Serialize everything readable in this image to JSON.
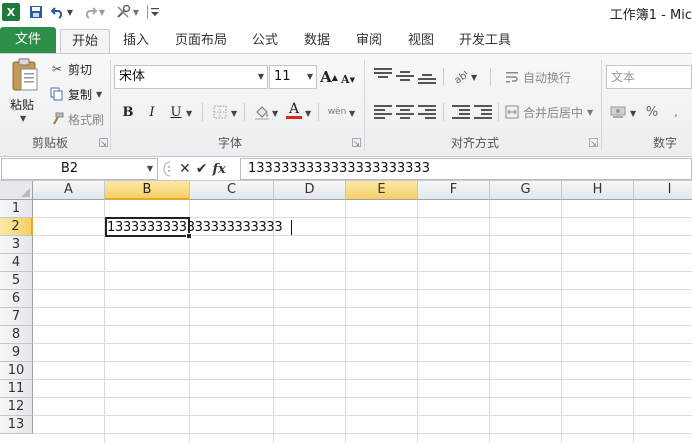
{
  "titlebar": {
    "app_icon": "X",
    "window_title": "工作簿1 - Mic",
    "icons": {
      "save": "save-icon",
      "undo": "undo-icon",
      "redo": "redo-icon",
      "tools": "tools-icon",
      "customize": "customize-quick-access-icon"
    }
  },
  "tabs": [
    {
      "label": "文件"
    },
    {
      "label": "开始"
    },
    {
      "label": "插入"
    },
    {
      "label": "页面布局"
    },
    {
      "label": "公式"
    },
    {
      "label": "数据"
    },
    {
      "label": "审阅"
    },
    {
      "label": "视图"
    },
    {
      "label": "开发工具"
    }
  ],
  "clipboard": {
    "paste_label": "粘贴",
    "cut_label": "剪切",
    "copy_label": "复制",
    "format_painter_label": "格式刷",
    "group_label": "剪贴板"
  },
  "font": {
    "font_name": "宋体",
    "font_size": "11",
    "grow_label": "A",
    "shrink_label": "A",
    "bold_label": "B",
    "italic_label": "I",
    "underline_label": "U",
    "font_color_label": "A",
    "phonetic_label": "wén",
    "group_label": "字体",
    "font_color": "#e2231a"
  },
  "alignment": {
    "wrap_text_label": "自动换行",
    "merge_center_label": "合并后居中",
    "group_label": "对齐方式"
  },
  "number": {
    "format_value": "文本",
    "percent_label": "%",
    "group_label": "数字"
  },
  "formula_bar": {
    "name_box": "B2",
    "fx_label": "fx",
    "content": "1333333333333333333333"
  },
  "sheet": {
    "columns": [
      "A",
      "B",
      "C",
      "D",
      "E",
      "F",
      "G",
      "H",
      "I"
    ],
    "rows": [
      "1",
      "2",
      "3",
      "4",
      "5",
      "6",
      "7",
      "8",
      "9",
      "10",
      "11",
      "12",
      "13"
    ],
    "selected_column": "B",
    "selected_row": "2",
    "active_cell": "B2",
    "cell_b2": "1333333333333333333333",
    "highlight_color": "#f6cf65",
    "file_tab_color": "#2d8e4a"
  }
}
